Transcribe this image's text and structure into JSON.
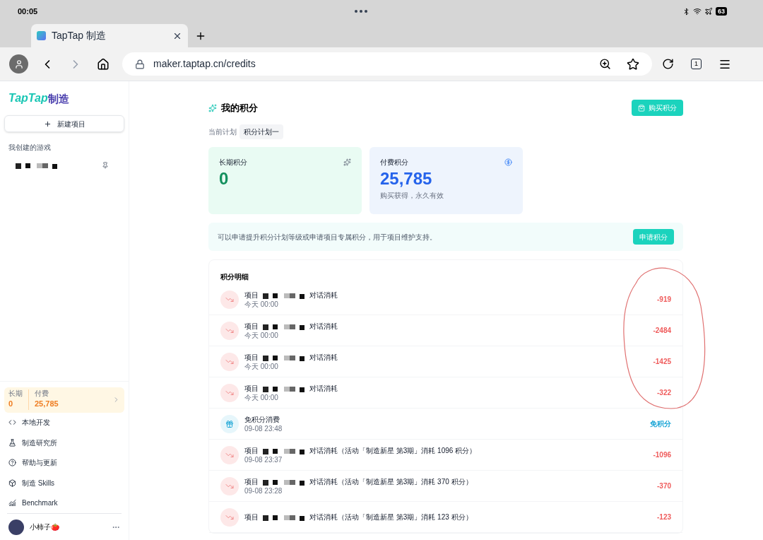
{
  "status_bar": {
    "time": "00:05",
    "battery": "63"
  },
  "browser": {
    "tab_title": "TapTap 制造",
    "url": "maker.taptap.cn/credits",
    "tab_count": "1"
  },
  "sidebar": {
    "logo": "TapTap",
    "logo_suffix": "制造",
    "new_project": "新建项目",
    "section_title": "我创建的游戏",
    "credits": {
      "long_label": "长期",
      "long_value": "0",
      "paid_label": "付费",
      "paid_value": "25,785"
    },
    "nav": [
      {
        "label": "本地开发"
      },
      {
        "label": "制造研究所"
      },
      {
        "label": "帮助与更新"
      },
      {
        "label": "制造 Skills"
      },
      {
        "label": "Benchmark"
      }
    ],
    "user": {
      "name": "小柿子🍅"
    }
  },
  "page": {
    "title": "我的积分",
    "buy_button": "购买积分",
    "plan_label": "当前计划",
    "plan_name": "积分计划一",
    "cards": [
      {
        "kind": "long",
        "label": "长期积分",
        "value": "0"
      },
      {
        "kind": "paid",
        "label": "付费积分",
        "value": "25,785",
        "note": "购买获得，永久有效"
      }
    ],
    "notice": {
      "text": "可以申请提升积分计划等级或申请项目专属积分，用于项目维护支持。",
      "button": "申请积分"
    },
    "detail": {
      "title": "积分明细",
      "rows": [
        {
          "kind": "consume",
          "prefix": "项目",
          "desc": "对话消耗",
          "time": "今天 00:00",
          "amount": "-919"
        },
        {
          "kind": "consume",
          "prefix": "项目",
          "desc": "对话消耗",
          "time": "今天 00:00",
          "amount": "-2484"
        },
        {
          "kind": "consume",
          "prefix": "项目",
          "desc": "对话消耗",
          "time": "今天 00:00",
          "amount": "-1425"
        },
        {
          "kind": "consume",
          "prefix": "项目",
          "desc": "对话消耗",
          "time": "今天 00:00",
          "amount": "-322"
        },
        {
          "kind": "free",
          "desc": "免积分消费",
          "time": "09-08 23:48",
          "amount": "免积分"
        },
        {
          "kind": "consume",
          "prefix": "项目",
          "desc": "对话消耗（活动「制造新星 第3期」消耗 1096 积分）",
          "time": "09-08 23:37",
          "amount": "-1096"
        },
        {
          "kind": "consume",
          "prefix": "项目",
          "desc": "对话消耗（活动「制造新星 第3期」消耗 370 积分）",
          "time": "09-08 23:28",
          "amount": "-370"
        },
        {
          "kind": "consume",
          "prefix": "项目",
          "desc": "对话消耗（活动「制造新星 第3期」消耗 123 积分）",
          "amount": "-123"
        }
      ]
    }
  }
}
